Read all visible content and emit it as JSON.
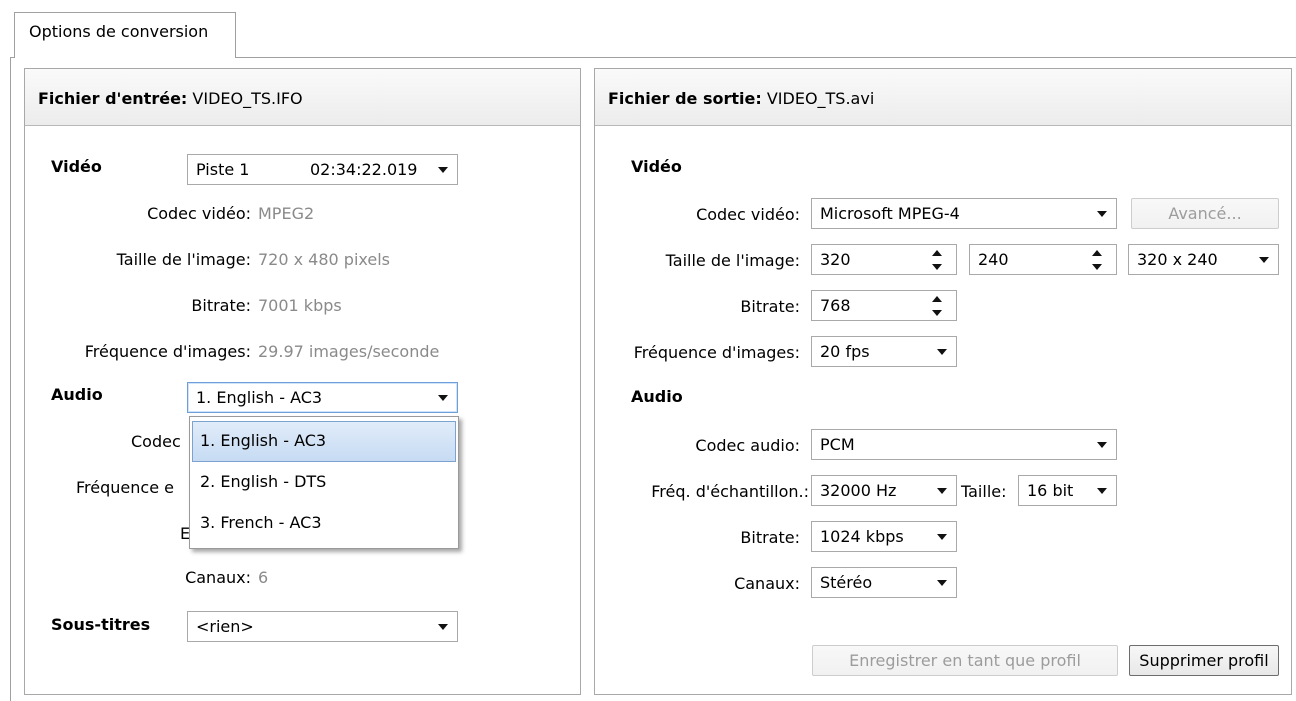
{
  "tab_label": "Options de conversion",
  "input_panel": {
    "header_bold": "Fichier d'entrée:",
    "header_file": "VIDEO_TS.IFO",
    "video_section": "Vidéo",
    "video_track": "Piste 1",
    "video_duration": "02:34:22.019",
    "codec_label": "Codec vidéo:",
    "codec_value": "MPEG2",
    "size_label": "Taille de l'image:",
    "size_value": "720 x 480 pixels",
    "bitrate_label": "Bitrate:",
    "bitrate_value": "7001 kbps",
    "fps_label": "Fréquence d'images:",
    "fps_value": "29.97 images/seconde",
    "audio_section": "Audio",
    "audio_selected": "1. English - AC3",
    "audio_codec_label_partial": "Codec",
    "audio_freq_label_partial": "Fréquence e",
    "audio_bitrate_label_partial": "E",
    "channels_label": "Canaux:",
    "channels_value": "6",
    "subtitles_section": "Sous-titres",
    "subtitles_value": "<rien>",
    "audio_dropdown_options": [
      "1. English - AC3",
      "2. English - DTS",
      "3. French - AC3"
    ]
  },
  "output_panel": {
    "header_bold": "Fichier de sortie:",
    "header_file": "VIDEO_TS.avi",
    "video_section": "Vidéo",
    "codec_label": "Codec vidéo:",
    "codec_value": "Microsoft MPEG-4",
    "advanced_button": "Avancé...",
    "size_label": "Taille de l'image:",
    "width_value": "320",
    "height_value": "240",
    "size_preset": "320 x 240",
    "bitrate_label": "Bitrate:",
    "bitrate_value": "768",
    "fps_label": "Fréquence d'images:",
    "fps_value": "20 fps",
    "audio_section": "Audio",
    "audio_codec_label": "Codec audio:",
    "audio_codec_value": "PCM",
    "sample_rate_label": "Fréq. d'échantillon.:",
    "sample_rate_value": "32000 Hz",
    "sample_size_label": "Taille:",
    "sample_size_value": "16 bit",
    "audio_bitrate_label": "Bitrate:",
    "audio_bitrate_value": "1024 kbps",
    "channels_label": "Canaux:",
    "channels_value": "Stéréo",
    "save_profile_button": "Enregistrer en tant que profil",
    "delete_profile_button": "Supprimer profil"
  }
}
